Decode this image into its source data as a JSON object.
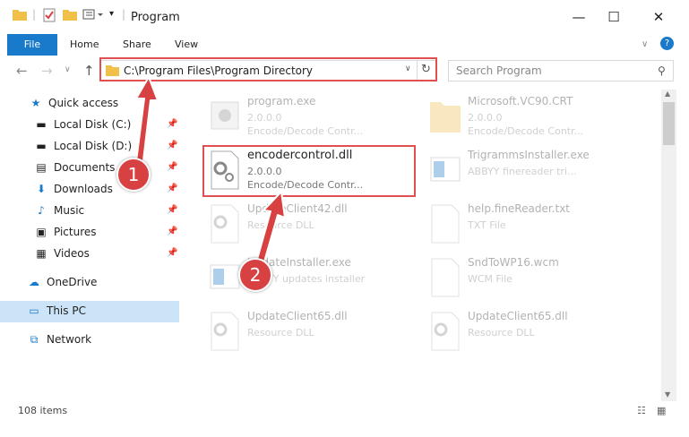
{
  "window": {
    "title": "Program"
  },
  "ribbon": {
    "file": "File",
    "home": "Home",
    "share": "Share",
    "view": "View"
  },
  "address": {
    "path": "C:\\Program Files\\Program Directory",
    "search_placeholder": "Search Program"
  },
  "sidebar": {
    "items": [
      {
        "label": "Quick access",
        "icon": "star-icon"
      },
      {
        "label": "Local Disk (C:)",
        "icon": "drive-icon"
      },
      {
        "label": "Local Disk (D:)",
        "icon": "drive-icon"
      },
      {
        "label": "Documents",
        "icon": "documents-icon"
      },
      {
        "label": "Downloads",
        "icon": "download-icon"
      },
      {
        "label": "Music",
        "icon": "music-icon"
      },
      {
        "label": "Pictures",
        "icon": "pictures-icon"
      },
      {
        "label": "Videos",
        "icon": "videos-icon"
      },
      {
        "label": "OneDrive",
        "icon": "cloud-icon"
      },
      {
        "label": "This PC",
        "icon": "computer-icon"
      },
      {
        "label": "Network",
        "icon": "network-icon"
      }
    ]
  },
  "files": [
    {
      "name": "program.exe",
      "line2": "2.0.0.0",
      "line3": "Encode/Decode Contr..."
    },
    {
      "name": "Microsoft.VC90.CRT",
      "line2": "2.0.0.0",
      "line3": "Encode/Decode Contr..."
    },
    {
      "name": "encodercontrol.dll",
      "line2": "2.0.0.0",
      "line3": "Encode/Decode Contr..."
    },
    {
      "name": "TrigrammsInstaller.exe",
      "line2": "ABBYY finereader tri..."
    },
    {
      "name": "UpdateClient42.dll",
      "line2": "Resource DLL"
    },
    {
      "name": "help.fineReader.txt",
      "line2": "TXT File"
    },
    {
      "name": "UpdateInstaller.exe",
      "line2": "ABBYY updates installer"
    },
    {
      "name": "SndToWP16.wcm",
      "line2": "WCM File"
    },
    {
      "name": "UpdateClient65.dll",
      "line2": "Resource DLL"
    },
    {
      "name": "UpdateClient65.dll",
      "line2": "Resource DLL"
    }
  ],
  "status": {
    "count": "108 items"
  },
  "steps": {
    "one": "1",
    "two": "2"
  },
  "colors": {
    "accent": "#1979ca",
    "highlight": "#e05050",
    "badge": "#d84141"
  }
}
